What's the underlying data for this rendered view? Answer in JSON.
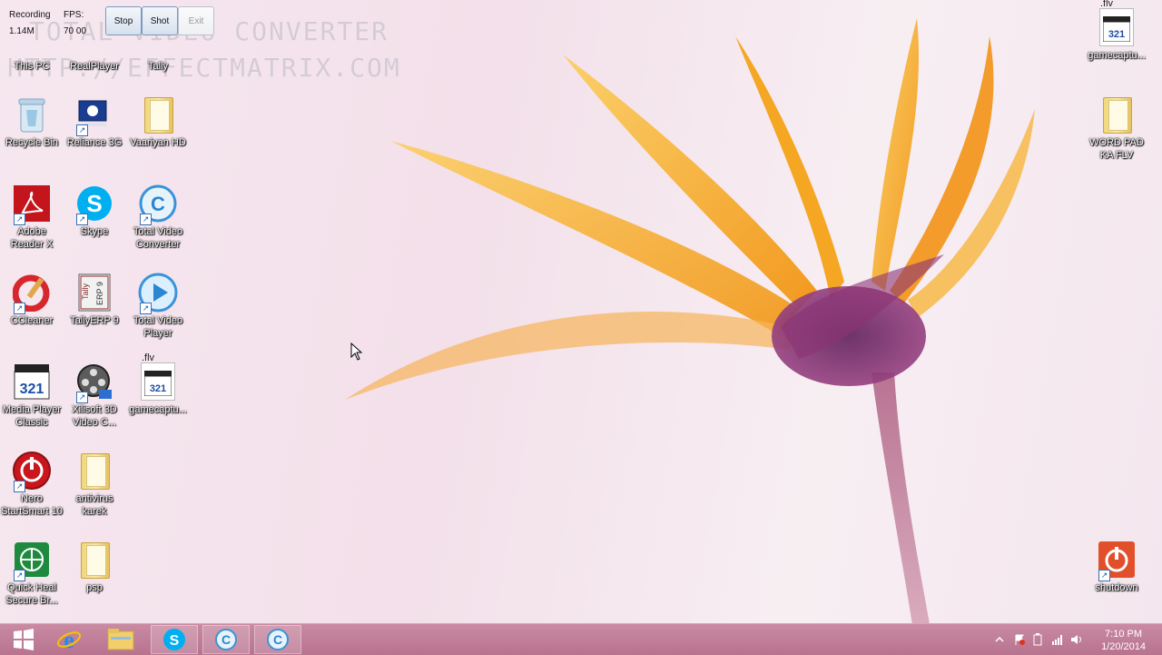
{
  "recorder": {
    "recording_label": "Recording",
    "size": "1.14M",
    "fps_label": "FPS:",
    "fps_value": "70 00",
    "stop": "Stop",
    "shot": "Shot",
    "exit": "Exit"
  },
  "watermark": {
    "line1": "TOTAL VIDEO CONVERTER",
    "line2": "HTTP://EFFECTMATRIX.COM"
  },
  "desktop_icons": [
    {
      "label": "This PC",
      "icon": "computer-icon"
    },
    {
      "label": "RealPlayer",
      "icon": "realplayer-icon"
    },
    {
      "label": "Tally",
      "icon": "tally-icon"
    },
    {
      "label": "Recycle Bin",
      "icon": "recycle-bin-icon"
    },
    {
      "label": "Reliance 3G",
      "icon": "reliance-3g-icon"
    },
    {
      "label": "Vaariyan HD",
      "icon": "folder-icon"
    },
    {
      "label": "Adobe Reader X",
      "icon": "adobe-reader-icon"
    },
    {
      "label": "Skype",
      "icon": "skype-icon"
    },
    {
      "label": "Total Video Converter",
      "icon": "total-video-converter-icon"
    },
    {
      "label": "CCleaner",
      "icon": "ccleaner-icon"
    },
    {
      "label": "TallyERP 9",
      "icon": "tally-erp-icon"
    },
    {
      "label": "Total Video Player",
      "icon": "total-video-player-icon"
    },
    {
      "label": "Media Player Classic",
      "icon": "media-player-classic-icon"
    },
    {
      "label": "Xilisoft 3D Video C...",
      "icon": "xilisoft-icon"
    },
    {
      "label": "gamecaptu...",
      "icon": "flv-file-icon"
    },
    {
      "label": "Nero StartSmart 10",
      "icon": "nero-icon"
    },
    {
      "label": "antivirus karek",
      "icon": "folder-icon"
    },
    {
      "label": "Quick Heal Secure Br...",
      "icon": "quick-heal-icon"
    },
    {
      "label": "psp",
      "icon": "folder-icon"
    },
    {
      "label": "gamecaptu...",
      "icon": "flv-file-icon"
    },
    {
      "label": "WORD PAD KA FLV",
      "icon": "folder-icon"
    },
    {
      "label": "shutdown",
      "icon": "shutdown-icon"
    }
  ],
  "flv_badge": ".flv",
  "flv_number": "321",
  "taskbar": {
    "items": [
      "start-button",
      "internet-explorer-icon",
      "file-explorer-icon",
      "skype-icon",
      "total-video-converter-icon",
      "total-video-converter-icon"
    ],
    "time": "7:10 PM",
    "date": "1/20/2014"
  },
  "colors": {
    "taskbar": "#b8738f",
    "desktop_bg": "#f4e6ee",
    "petal": "#f5a623",
    "flower_center": "#7a2d6a"
  }
}
